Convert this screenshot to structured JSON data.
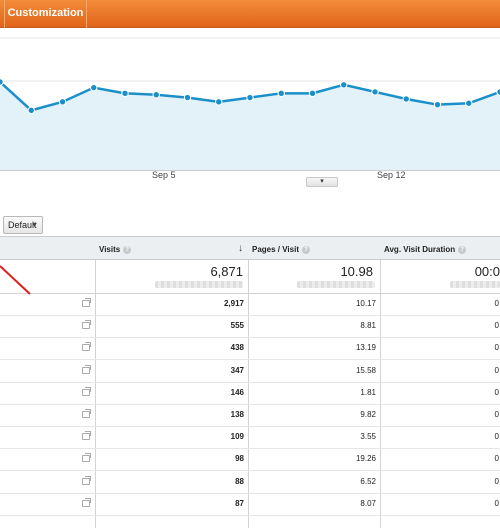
{
  "topbar": {
    "tab_label": "Customization"
  },
  "chart": {
    "x_tick_labels": [
      "Sep 5",
      "Sep 12"
    ],
    "slider_grip": "|||",
    "collapse_caret": "▾"
  },
  "chart_data": {
    "type": "area",
    "series": [
      {
        "values": [
          62,
          42,
          48,
          58,
          54,
          53,
          51,
          48,
          51,
          54,
          54,
          60,
          55,
          50,
          46,
          47,
          55
        ]
      }
    ],
    "ylim": [
      0,
      100
    ]
  },
  "toolbar": {
    "default_label": "Default",
    "caret": "▼"
  },
  "table": {
    "headers": {
      "visits": "Visits",
      "pages_per_visit": "Pages / Visit",
      "avg_visit_duration": "Avg. Visit Duration",
      "help_glyph": "?",
      "sort_glyph": "↓"
    },
    "totals": {
      "visits": "6,871",
      "pages_per_visit": "10.98",
      "avg_visit_duration": "00:0"
    },
    "rows": [
      {
        "visits": "2,917",
        "ppv": "10.17",
        "dur": "0"
      },
      {
        "visits": "555",
        "ppv": "8.81",
        "dur": "0"
      },
      {
        "visits": "438",
        "ppv": "13.19",
        "dur": "0"
      },
      {
        "visits": "347",
        "ppv": "15.58",
        "dur": "0"
      },
      {
        "visits": "146",
        "ppv": "1.81",
        "dur": "0"
      },
      {
        "visits": "138",
        "ppv": "9.82",
        "dur": "0"
      },
      {
        "visits": "109",
        "ppv": "3.55",
        "dur": "0"
      },
      {
        "visits": "98",
        "ppv": "19.26",
        "dur": "0"
      },
      {
        "visits": "88",
        "ppv": "6.52",
        "dur": "0"
      },
      {
        "visits": "87",
        "ppv": "8.07",
        "dur": "0"
      }
    ]
  },
  "colors": {
    "accent_orange": "#e8742a",
    "line_blue": "#1a8fc9",
    "area_fill": "#e3f1f9"
  }
}
